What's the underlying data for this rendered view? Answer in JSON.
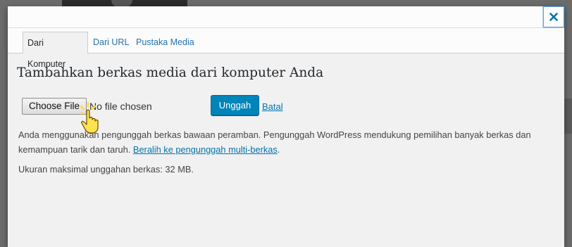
{
  "modal": {
    "close_label": "close",
    "tabs": [
      {
        "label": "Dari Komputer",
        "active": true
      },
      {
        "label": "Dari URL",
        "active": false
      },
      {
        "label": "Pustaka Media",
        "active": false
      }
    ],
    "title": "Tambahkan berkas media dari komputer Anda",
    "file_button_label": "Choose File",
    "file_status": "No file chosen",
    "upload_button_label": "Unggah",
    "cancel_link_label": "Batal",
    "info_text": "Anda menggunakan pengunggah berkas bawaan peramban. Pengunggah WordPress mendukung pemilihan banyak berkas dan kemampuan tarik dan taruh.",
    "info_link_label": "Beralih ke pengunggah multi-berkas",
    "info_tail": ".",
    "max_size_text": "Ukuran maksimal unggahan berkas: 32 MB."
  },
  "colors": {
    "accent": "#0085ba",
    "link": "#0073aa",
    "cursor_highlight": "#ffd84d"
  }
}
